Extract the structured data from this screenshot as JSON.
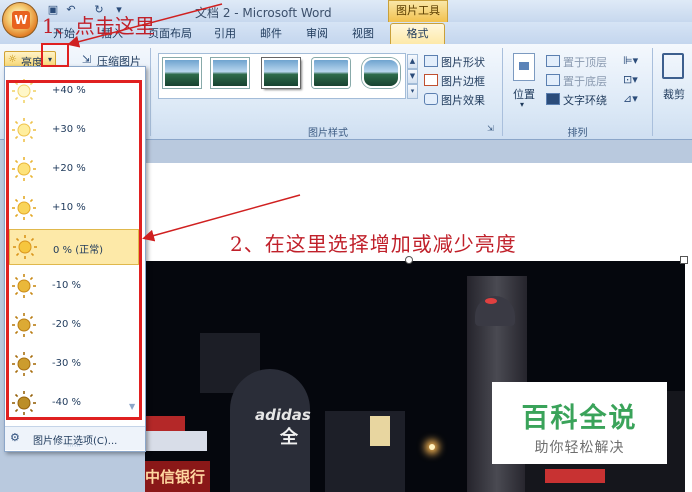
{
  "window": {
    "title": "文档 2 - Microsoft Word",
    "picture_tools": "图片工具"
  },
  "tabs": [
    "开始",
    "插入",
    "页面布局",
    "引用",
    "邮件",
    "审阅",
    "视图"
  ],
  "active_tab": "格式",
  "ribbon": {
    "brightness_btn": "亮度",
    "compress_btn": "压缩图片",
    "shape_btn": "图片形状",
    "border_btn": "图片边框",
    "effects_btn": "图片效果",
    "styles_group": "图片样式",
    "position_btn": "位置",
    "bring_front": "置于顶层",
    "send_back": "置于底层",
    "text_wrap": "文字环绕",
    "arrange_group": "排列",
    "crop_btn": "裁剪"
  },
  "brightness_menu": {
    "items": [
      "+40 %",
      "+30 %",
      "+20 %",
      "+10 %",
      "0 % (正常)",
      "-10 %",
      "-20 %",
      "-30 %",
      "-40 %"
    ],
    "selected_index": 4,
    "footer": "图片修正选项(C)..."
  },
  "annotations": {
    "step1": "1、点击这里",
    "step2": "2、在这里选择增加或减少亮度"
  },
  "photo_signs": {
    "sign1": "中信银行",
    "sign2": "adidas",
    "sign3": "全"
  },
  "watermark": {
    "title": "百科全说",
    "subtitle": "助你轻松解决"
  },
  "colors": {
    "annotation_red": "#e02020",
    "accent_orange": "#e8631e",
    "watermark_green": "#3aa35a"
  }
}
